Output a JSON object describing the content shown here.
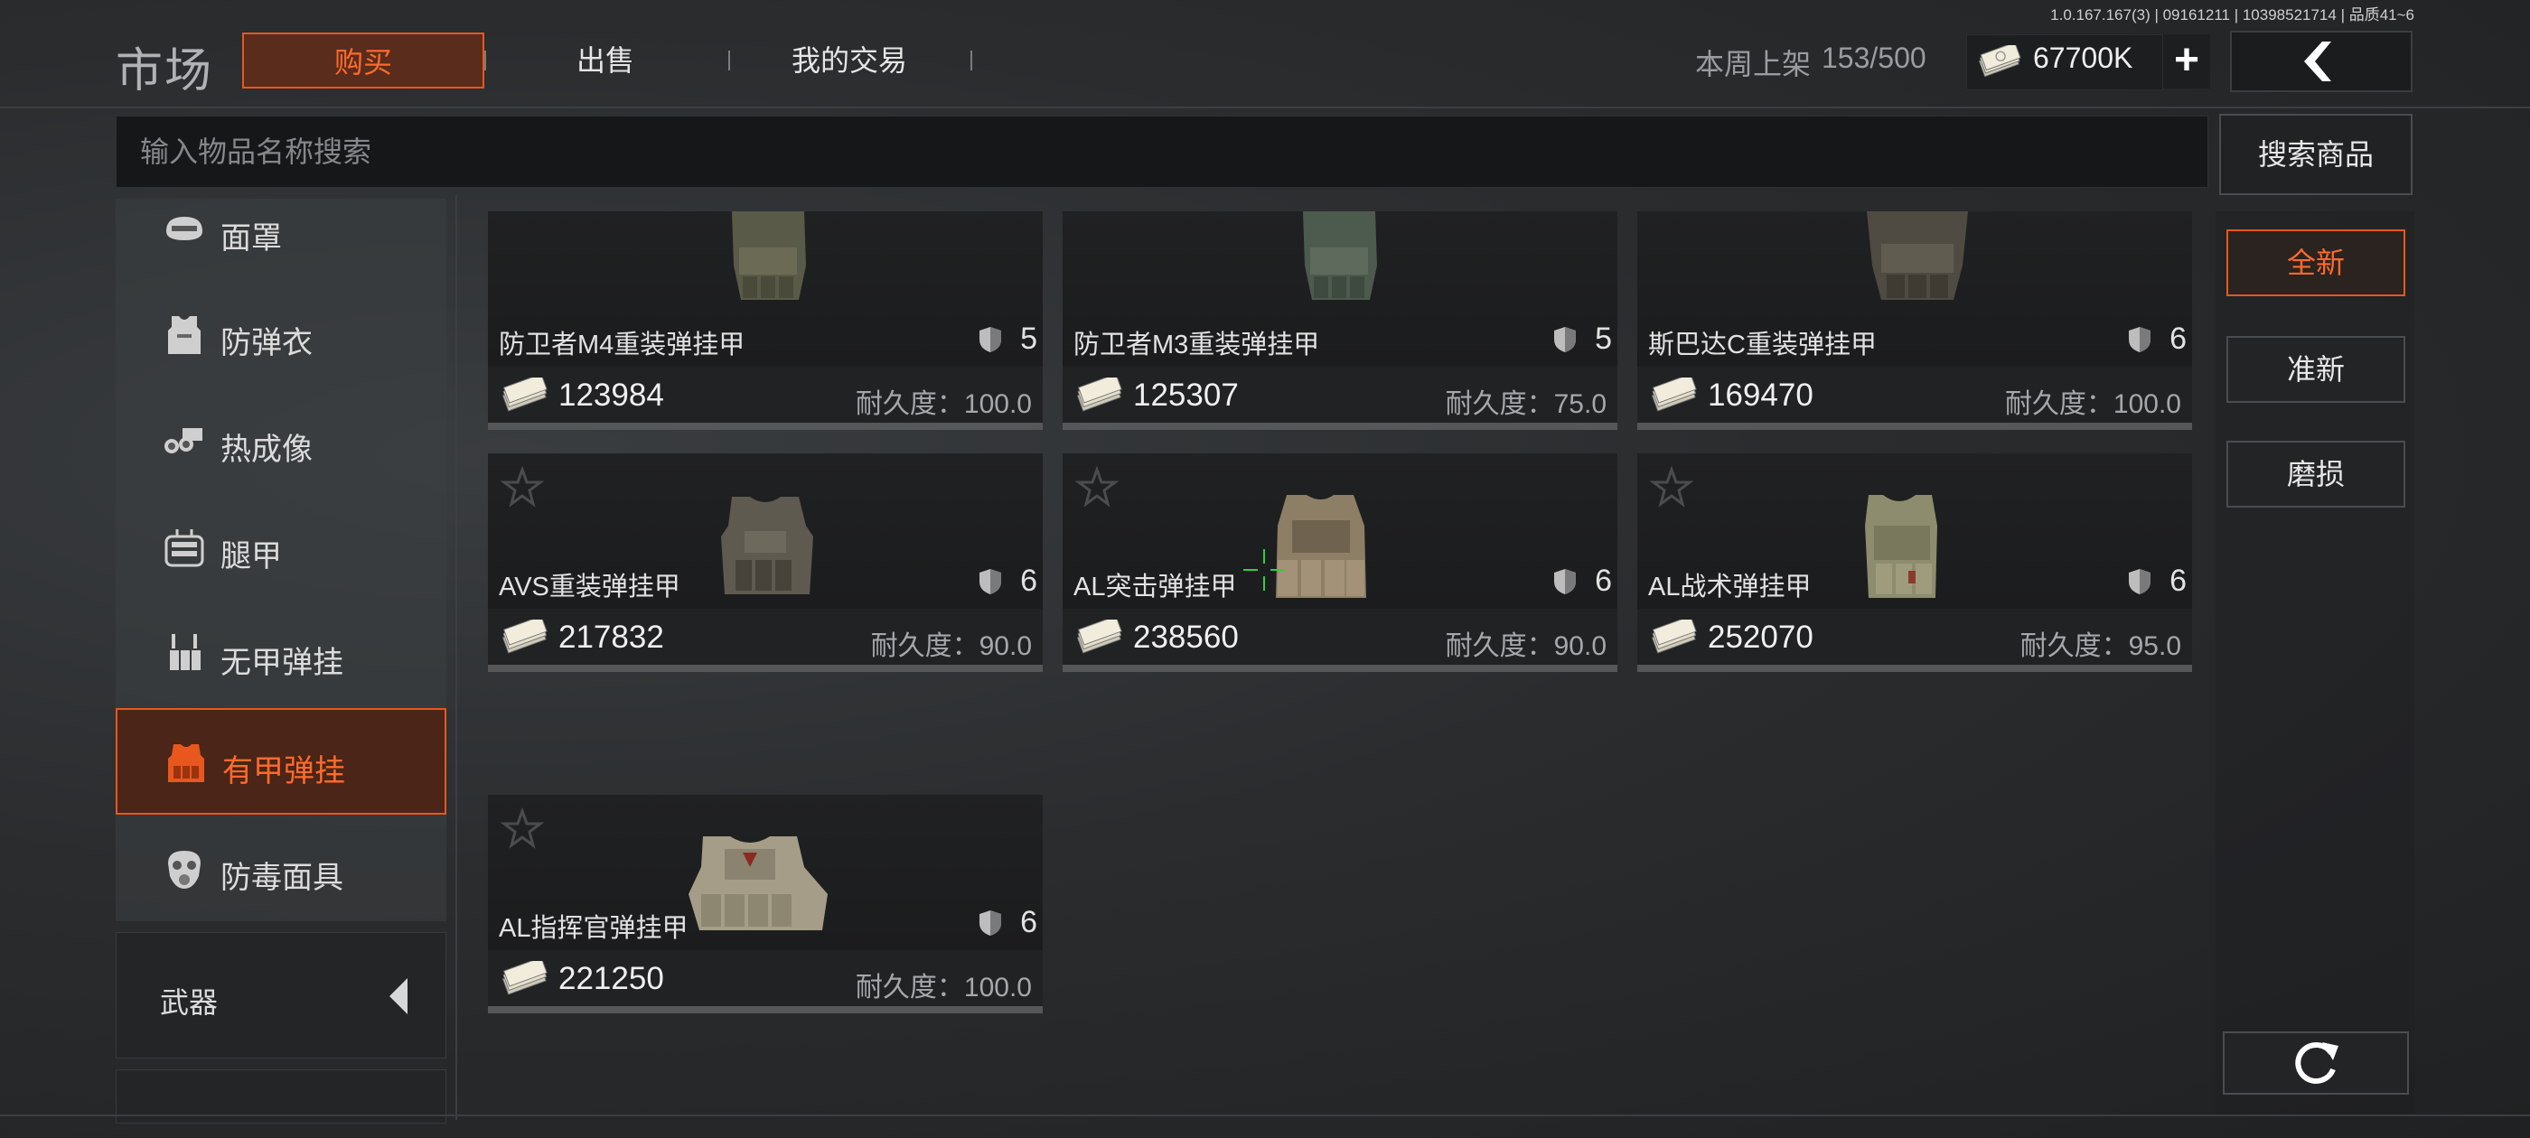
{
  "version": "1.0.167.167(3) | 09161211 | 10398521714 | 品质41~6",
  "header": {
    "title": "市场",
    "tabs": [
      {
        "label": "购买",
        "active": true
      },
      {
        "label": "出售",
        "active": false
      },
      {
        "label": "我的交易",
        "active": false
      }
    ],
    "weekly_label": "本周上架",
    "weekly_value": "153/500",
    "money": "67700K",
    "accent_color": "#e8571d"
  },
  "search": {
    "placeholder": "输入物品名称搜索",
    "value": "",
    "button": "搜索商品"
  },
  "sidebar": {
    "items": [
      {
        "label": "面罩",
        "icon": "mask-icon",
        "active": false
      },
      {
        "label": "防弹衣",
        "icon": "body-armor-icon",
        "active": false
      },
      {
        "label": "热成像",
        "icon": "thermal-icon",
        "active": false
      },
      {
        "label": "腿甲",
        "icon": "leg-armor-icon",
        "active": false
      },
      {
        "label": "无甲弹挂",
        "icon": "chest-rig-icon",
        "active": false
      },
      {
        "label": "有甲弹挂",
        "icon": "armored-rig-icon",
        "active": true
      },
      {
        "label": "防毒面具",
        "icon": "gas-mask-icon",
        "active": false
      }
    ],
    "weapons_label": "武器"
  },
  "items": [
    {
      "name": "防卫者M4重装弹挂甲",
      "level": "5",
      "price": "123984",
      "durability": "耐久度：100.0"
    },
    {
      "name": "防卫者M3重装弹挂甲",
      "level": "5",
      "price": "125307",
      "durability": "耐久度：75.0"
    },
    {
      "name": "斯巴达C重装弹挂甲",
      "level": "6",
      "price": "169470",
      "durability": "耐久度：100.0"
    },
    {
      "name": "AVS重装弹挂甲",
      "level": "6",
      "price": "217832",
      "durability": "耐久度：90.0"
    },
    {
      "name": "AL突击弹挂甲",
      "level": "6",
      "price": "238560",
      "durability": "耐久度：90.0"
    },
    {
      "name": "AL战术弹挂甲",
      "level": "6",
      "price": "252070",
      "durability": "耐久度：95.0"
    },
    {
      "name": "AL指挥官弹挂甲",
      "level": "6",
      "price": "221250",
      "durability": "耐久度：100.0"
    }
  ],
  "filters": [
    {
      "label": "全新",
      "active": true
    },
    {
      "label": "准新",
      "active": false
    },
    {
      "label": "磨损",
      "active": false
    }
  ]
}
